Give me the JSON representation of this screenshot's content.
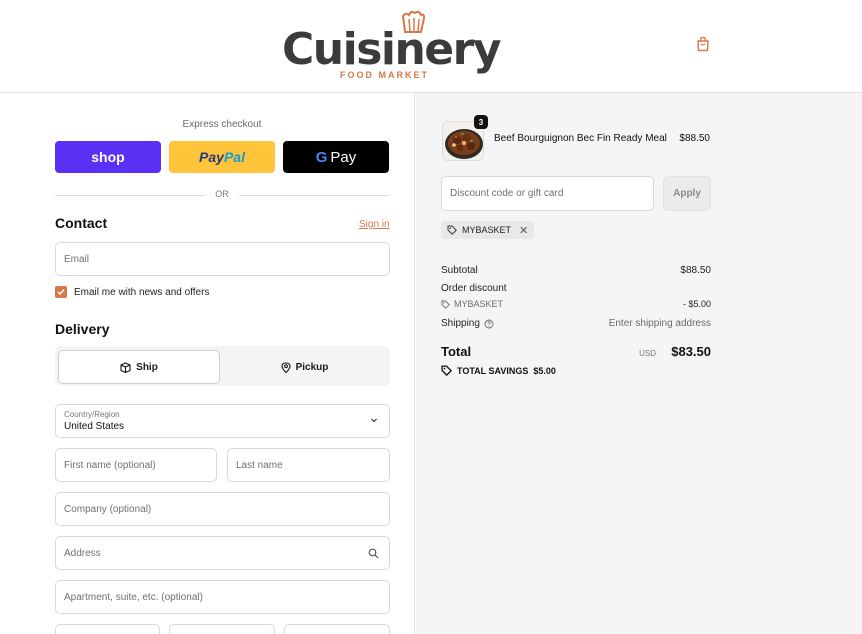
{
  "brand": {
    "name": "Cuisinery",
    "tagline": "FOOD MARKET",
    "accent": "#d9774b"
  },
  "header": {
    "cart_icon": "shopping-bag-icon"
  },
  "express": {
    "label": "Express checkout",
    "buttons": {
      "shop": "shop",
      "paypal_a": "Pay",
      "paypal_b": "Pal",
      "gpay_g": "G",
      "gpay": "Pay"
    },
    "or": "OR"
  },
  "contact": {
    "title": "Contact",
    "sign_in": "Sign in",
    "email_placeholder": "Email",
    "newsletter_label": "Email me with news and offers",
    "newsletter_checked": true
  },
  "delivery": {
    "title": "Delivery",
    "tabs": {
      "ship": "Ship",
      "pickup": "Pickup",
      "selected": "ship"
    },
    "country_label": "Country/Region",
    "country_value": "United States",
    "first_name_placeholder": "First name (optional)",
    "last_name_placeholder": "Last name",
    "company_placeholder": "Company (optional)",
    "address_placeholder": "Address",
    "apartment_placeholder": "Apartment, suite, etc. (optional)"
  },
  "order": {
    "item": {
      "name": "Beef Bourguignon Bec Fin Ready Meal",
      "price": "$88.50",
      "quantity": "3"
    },
    "discount_placeholder": "Discount code or gift card",
    "apply_label": "Apply",
    "applied_code": "MYBASKET",
    "subtotal_label": "Subtotal",
    "subtotal_value": "$88.50",
    "order_discount_label": "Order discount",
    "discount_code": "MYBASKET",
    "discount_value": "- $5.00",
    "shipping_label": "Shipping",
    "shipping_value": "Enter shipping address",
    "total_label": "Total",
    "total_currency": "USD",
    "total_value": "$83.50",
    "savings_label": "TOTAL SAVINGS",
    "savings_value": "$5.00"
  }
}
